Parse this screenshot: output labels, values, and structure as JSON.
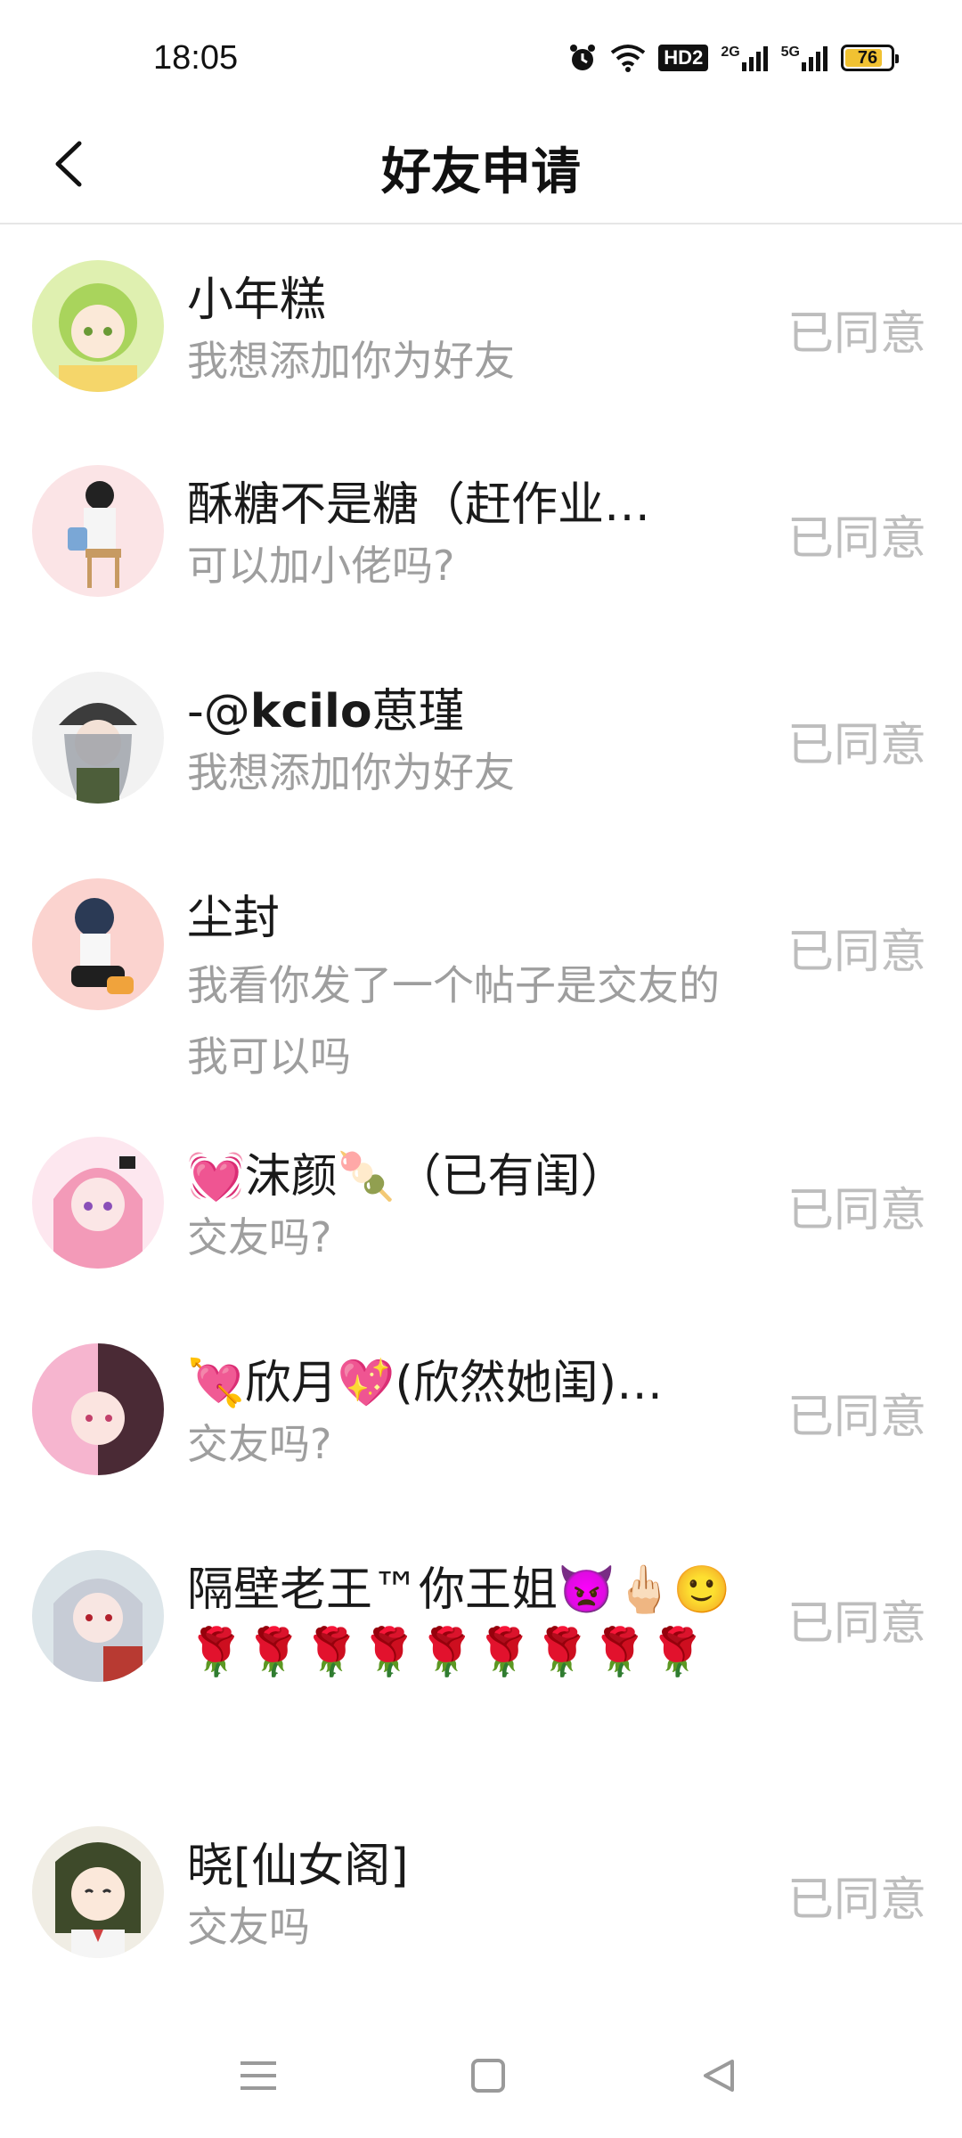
{
  "status_bar": {
    "time": "18:05",
    "hd_label": "HD2",
    "net1": "2G",
    "net2": "5G",
    "battery": "76",
    "icons": [
      "alarm-icon",
      "wifi-icon",
      "hd-icon",
      "signal-icon",
      "signal-icon",
      "battery-icon"
    ]
  },
  "header": {
    "title": "好友申请",
    "back_icon": "chevron-left-icon"
  },
  "requests": [
    {
      "name": "小年糕",
      "message": "我想添加你为好友",
      "status": "已同意"
    },
    {
      "name": "酥糖不是糖（赶作业…",
      "message": "可以加小佬吗?",
      "status": "已同意"
    },
    {
      "name_prefix": "-@",
      "name_bold": "kcilo",
      "name_suffix": "葸瑾",
      "message": "我想添加你为好友",
      "status": "已同意"
    },
    {
      "name": "尘封",
      "message": "我看你发了一个帖子是交友的我可以吗",
      "status": "已同意"
    },
    {
      "name": "💓沫颜🍡（已有闺）",
      "message": "交友吗?",
      "status": "已同意"
    },
    {
      "name": "💘欣月💖(欣然她闺)…",
      "message": "交友吗?",
      "status": "已同意"
    },
    {
      "name": "隔壁老王™你王姐👿🖕🏻🙂🌹🌹🌹🌹🌹🌹🌹🌹🌹",
      "message": "",
      "status": "已同意"
    },
    {
      "name": "晓[仙女阁]",
      "message": "交友吗",
      "status": "已同意"
    }
  ],
  "nav": {
    "icons": [
      "menu-icon",
      "home-square-icon",
      "back-triangle-icon"
    ]
  },
  "colors": {
    "status_text": "#bdbdbd",
    "message_text": "#9e9e9e",
    "battery": "#f1c232"
  }
}
